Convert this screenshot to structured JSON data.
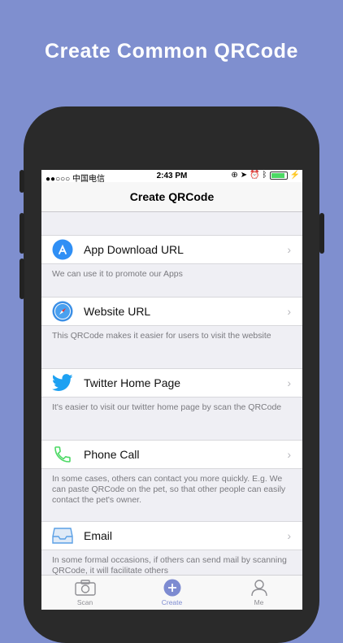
{
  "headline": "Create Common QRCode",
  "status": {
    "carrier": "●●○○○ 中国电信",
    "time": "2:43 PM"
  },
  "nav": {
    "title": "Create QRCode"
  },
  "items": [
    {
      "label": "App Download URL",
      "desc": "We can use it to promote our Apps",
      "icon": "app-store-icon"
    },
    {
      "label": "Website URL",
      "desc": "This QRCode makes it easier for users to visit the website",
      "icon": "safari-compass-icon"
    },
    {
      "label": "Twitter Home Page",
      "desc": "It's easier to visit our twitter home page by scan the QRCode",
      "icon": "twitter-bird-icon"
    },
    {
      "label": "Phone Call",
      "desc": "In some cases, others can contact you more quickly. E.g. We can paste QRCode on the pet, so that other people can easily contact the pet's owner.",
      "icon": "phone-icon"
    },
    {
      "label": "Email",
      "desc": "In some formal occasions, if others can send mail by scanning QRCode, it will facilitate others",
      "icon": "inbox-tray-icon"
    }
  ],
  "tabs": [
    {
      "label": "Scan",
      "icon": "camera-icon",
      "active": false
    },
    {
      "label": "Create",
      "icon": "plus-circle-icon",
      "active": true
    },
    {
      "label": "Me",
      "icon": "person-icon",
      "active": false
    }
  ],
  "colors": {
    "background": "#7f8fcf",
    "accent": "#7d8bd1",
    "twitter": "#1da1f2",
    "phone": "#4cd964",
    "appstore": "#2f8ff5"
  }
}
